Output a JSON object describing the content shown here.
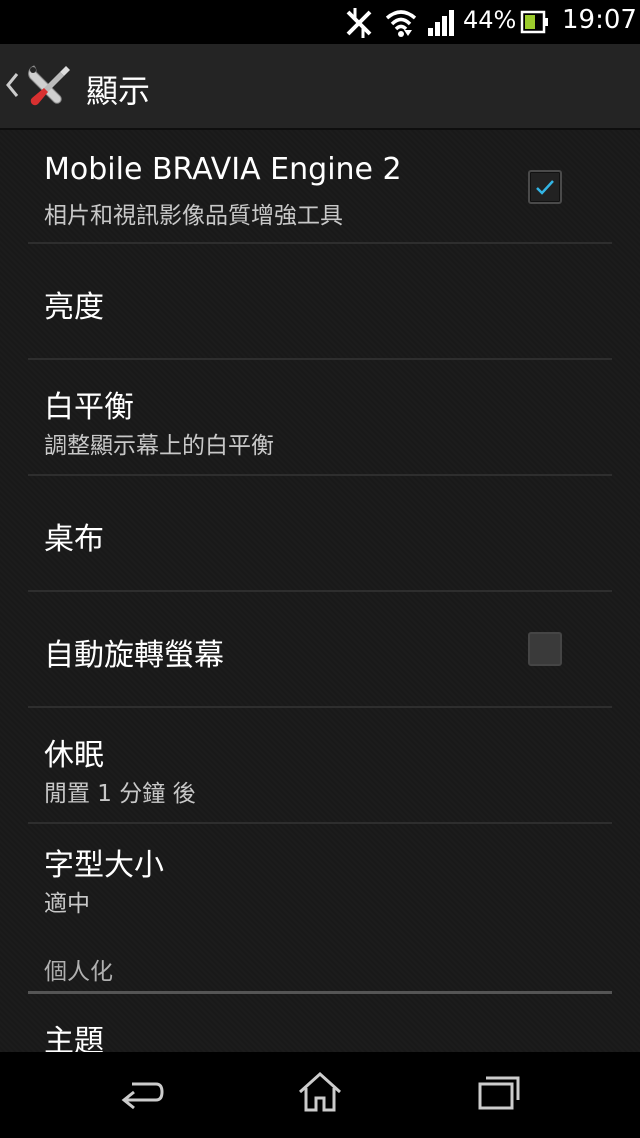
{
  "status_bar": {
    "battery_percent": "44%",
    "time": "19:07",
    "icons": [
      "nfc-off-icon",
      "wifi-icon",
      "signal-icon",
      "battery-icon"
    ]
  },
  "action_bar": {
    "title": "顯示",
    "icons": [
      "back-chevron-icon",
      "tools-icon"
    ]
  },
  "preferences": [
    {
      "title": "Mobile BRAVIA Engine 2",
      "summary": "相片和視訊影像品質增強工具",
      "checkbox": true
    },
    {
      "title": "亮度",
      "summary": "",
      "checkbox": null
    },
    {
      "title": "白平衡",
      "summary": "調整顯示幕上的白平衡",
      "checkbox": null
    },
    {
      "title": "桌布",
      "summary": "",
      "checkbox": null
    },
    {
      "title": "自動旋轉螢幕",
      "summary": "",
      "checkbox": false
    },
    {
      "title": "休眠",
      "summary": "閒置 1 分鐘 後",
      "checkbox": null
    },
    {
      "title": "字型大小",
      "summary": "適中",
      "checkbox": null
    }
  ],
  "category": {
    "label": "個人化"
  },
  "partial_item": {
    "title": "主題"
  },
  "nav_bar": {
    "icons": [
      "back-icon",
      "home-icon",
      "recent-apps-icon"
    ]
  },
  "colors": {
    "accent": "#33b5e5",
    "background": "#191919",
    "action_bar": "#242424"
  }
}
